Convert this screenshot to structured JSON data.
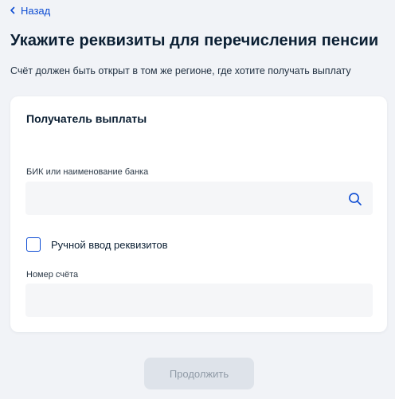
{
  "nav": {
    "back_label": "Назад"
  },
  "header": {
    "title": "Укажите реквизиты для перечисления пенсии",
    "subtitle": "Счёт должен быть открыт в том же регионе, где хотите получать выплату"
  },
  "form": {
    "heading": "Получатель выплаты",
    "bank": {
      "label": "БИК или наименование банка",
      "value": "",
      "icon": "search-icon"
    },
    "manual_entry": {
      "label": "Ручной ввод реквизитов",
      "checked": false
    },
    "account": {
      "label": "Номер счёта",
      "value": ""
    }
  },
  "actions": {
    "continue_label": "Продолжить",
    "continue_disabled": true
  },
  "colors": {
    "accent": "#0d4cd3",
    "background": "#f1f3f7",
    "card": "#ffffff",
    "input_fill": "#f5f6f8",
    "button_disabled_bg": "#dee3ea",
    "button_disabled_text": "#8f9aa6"
  }
}
